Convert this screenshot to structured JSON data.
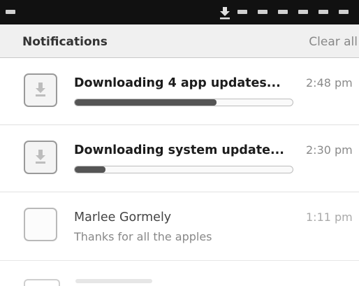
{
  "header": {
    "title": "Notifications",
    "clear_label": "Clear all"
  },
  "notifications": [
    {
      "title": "Downloading 4 app updates...",
      "time": "2:48 pm",
      "icon": "download-icon",
      "progress": 0.65
    },
    {
      "title": "Downloading system update...",
      "time": "2:30 pm",
      "icon": "download-icon",
      "progress": 0.14
    },
    {
      "title": "Marlee Gormely",
      "subtitle": "Thanks for all the apples",
      "time": "1:11 pm",
      "icon": "blank-app-icon"
    }
  ],
  "status_bar": {
    "icons": [
      "status-icon",
      "download-icon",
      "status-icon",
      "status-icon",
      "status-icon",
      "status-icon",
      "status-icon",
      "status-icon"
    ]
  }
}
